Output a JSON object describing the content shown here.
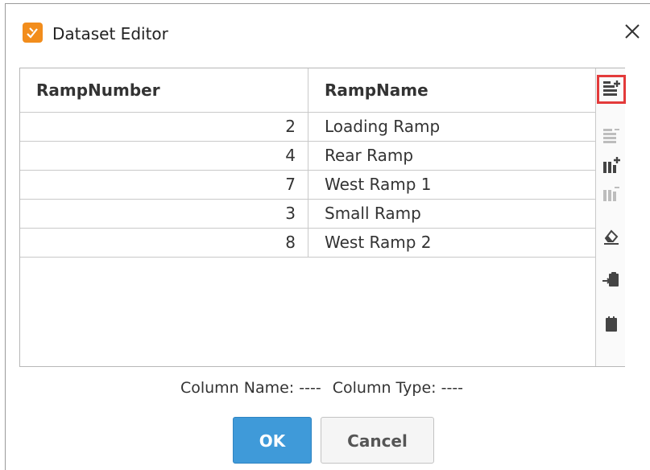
{
  "dialog": {
    "title": "Dataset Editor"
  },
  "table": {
    "columns": [
      "RampNumber",
      "RampName"
    ],
    "rows": [
      [
        "2",
        "Loading Ramp"
      ],
      [
        "4",
        "Rear Ramp"
      ],
      [
        "7",
        "West Ramp 1"
      ],
      [
        "3",
        "Small Ramp"
      ],
      [
        "8",
        "West Ramp 2"
      ]
    ]
  },
  "status": {
    "column_name": "Column Name: ----",
    "column_type": "Column Type: ----"
  },
  "buttons": {
    "ok": "OK",
    "cancel": "Cancel"
  },
  "toolbar": {
    "icons": [
      "add-row-icon",
      "delete-row-icon",
      "add-column-icon",
      "delete-column-icon",
      "eraser-icon",
      "paste-icon",
      "clipboard-icon"
    ]
  },
  "colors": {
    "ok_button": "#3f9ad9",
    "highlight": "#e33a3a",
    "app_icon": "#f28d1c"
  }
}
